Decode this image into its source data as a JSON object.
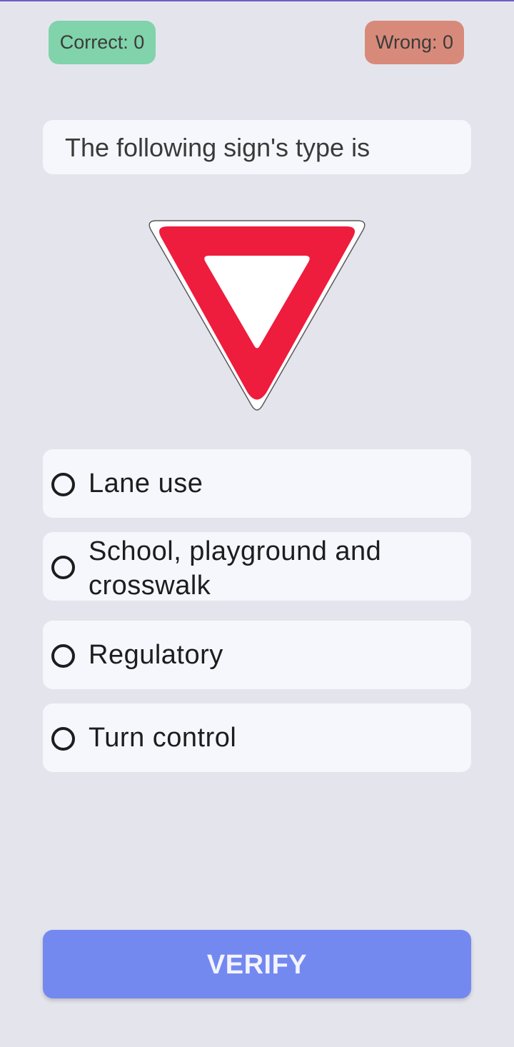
{
  "score": {
    "correct_label": "Correct: 0",
    "wrong_label": "Wrong: 0"
  },
  "question": {
    "text": "The following sign's type is"
  },
  "sign": {
    "icon": "yield-sign-icon",
    "colors": {
      "red": "#ee1c3d",
      "white": "#ffffff",
      "outline": "#5a5a5a"
    }
  },
  "options": [
    {
      "label": "Lane use"
    },
    {
      "label": "School, playground and crosswalk"
    },
    {
      "label": "Regulatory"
    },
    {
      "label": "Turn control"
    }
  ],
  "verify": {
    "label": "VERIFY"
  },
  "colors": {
    "background": "#e4e5ec",
    "card": "#f6f7fc",
    "correct_badge": "#80d3aa",
    "wrong_badge": "#d88a7a",
    "verify_button": "#7489f0"
  }
}
